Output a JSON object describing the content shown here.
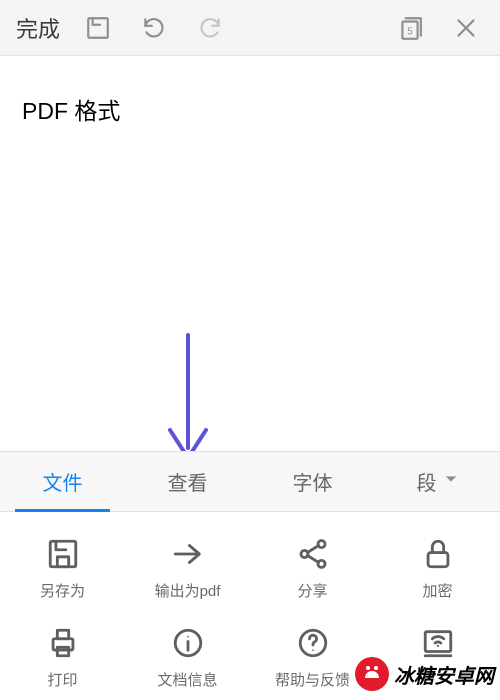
{
  "topbar": {
    "done_label": "完成",
    "page_indicator": "5"
  },
  "document": {
    "heading": "PDF 格式"
  },
  "panel": {
    "tabs": [
      {
        "label": "文件",
        "active": true
      },
      {
        "label": "查看",
        "active": false
      },
      {
        "label": "字体",
        "active": false
      },
      {
        "label": "段",
        "active": false
      }
    ]
  },
  "actions": {
    "row1": [
      {
        "icon": "save-as-icon",
        "label": "另存为"
      },
      {
        "icon": "export-pdf-icon",
        "label": "输出为pdf"
      },
      {
        "icon": "share-icon",
        "label": "分享"
      },
      {
        "icon": "lock-icon",
        "label": "加密"
      }
    ],
    "row2": [
      {
        "icon": "print-icon",
        "label": "打印"
      },
      {
        "icon": "info-icon",
        "label": "文档信息"
      },
      {
        "icon": "help-icon",
        "label": "帮助与反馈"
      },
      {
        "icon": "cast-icon",
        "label": ""
      }
    ]
  },
  "watermark": {
    "text": "冰糖安卓网"
  },
  "colors": {
    "accent": "#1584f2",
    "annotation": "#5a55d6"
  }
}
